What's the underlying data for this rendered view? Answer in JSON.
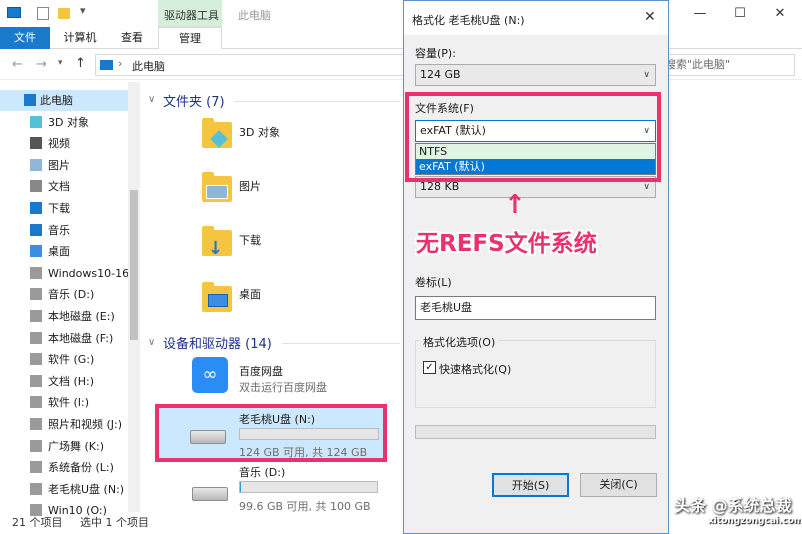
{
  "explorer": {
    "title": "此电脑",
    "context_tab": "驱动器工具",
    "tabs": [
      "文件",
      "计算机",
      "查看",
      "管理"
    ],
    "address": "此电脑",
    "search_placeholder": "搜索\"此电脑\"",
    "sidebar": [
      {
        "label": "此电脑",
        "icon": "pc-icon",
        "selected": true
      },
      {
        "label": "3D 对象",
        "icon": "3d-objects-icon"
      },
      {
        "label": "视频",
        "icon": "video-icon"
      },
      {
        "label": "图片",
        "icon": "pictures-icon"
      },
      {
        "label": "文档",
        "icon": "documents-icon"
      },
      {
        "label": "下载",
        "icon": "download-icon"
      },
      {
        "label": "音乐",
        "icon": "music-icon"
      },
      {
        "label": "桌面",
        "icon": "desktop-icon"
      },
      {
        "label": "Windows10-16",
        "icon": "drive-icon"
      },
      {
        "label": "音乐 (D:)",
        "icon": "drive-icon"
      },
      {
        "label": "本地磁盘 (E:)",
        "icon": "drive-icon"
      },
      {
        "label": "本地磁盘 (F:)",
        "icon": "drive-icon"
      },
      {
        "label": "软件 (G:)",
        "icon": "drive-icon"
      },
      {
        "label": "文档 (H:)",
        "icon": "drive-icon"
      },
      {
        "label": "软件  (I:)",
        "icon": "drive-icon"
      },
      {
        "label": "照片和视频 (J:)",
        "icon": "drive-icon"
      },
      {
        "label": "广场舞 (K:)",
        "icon": "drive-icon"
      },
      {
        "label": "系统备份 (L:)",
        "icon": "drive-icon"
      },
      {
        "label": "老毛桃U盘 (N:)",
        "icon": "usb-drive-icon"
      },
      {
        "label": "Win10 (O:)",
        "icon": "drive-icon"
      }
    ],
    "folders_header": "文件夹 (7)",
    "folders": [
      "3D 对象",
      "图片",
      "下载",
      "桌面"
    ],
    "devices_header": "设备和驱动器 (14)",
    "baidu": {
      "name": "百度网盘",
      "sub": "双击运行百度网盘"
    },
    "usb": {
      "name": "老毛桃U盘 (N:)",
      "free": "124 GB 可用, 共 124 GB",
      "used_fraction": 0.0
    },
    "music_drive": {
      "name": "音乐 (D:)",
      "free": "99.6 GB 可用, 共 100 GB",
      "used_fraction": 0.004
    },
    "status": {
      "count": "21 个项目",
      "selected": "选中 1 个项目"
    }
  },
  "dialog": {
    "title": "格式化 老毛桃U盘 (N:)",
    "capacity_label": "容量(P):",
    "capacity_value": "124 GB",
    "fs_label": "文件系统(F)",
    "fs_value": "exFAT (默认)",
    "fs_options": [
      "NTFS",
      "exFAT (默认)"
    ],
    "alloc_value": "128 KB",
    "volume_label": "卷标(L)",
    "volume_value": "老毛桃U盘",
    "options_label": "格式化选项(O)",
    "quick_format": "快速格式化(Q)",
    "quick_format_checked": true,
    "start_button": "开始(S)",
    "close_button": "关闭(C)"
  },
  "annotation": "无REFS文件系统",
  "watermark": {
    "main": "头条 @系统总裁",
    "sub": "xitongzongcai.com"
  },
  "colors": {
    "accent": "#1979ca",
    "highlight": "#e8336f",
    "selection": "#cce8ff"
  }
}
